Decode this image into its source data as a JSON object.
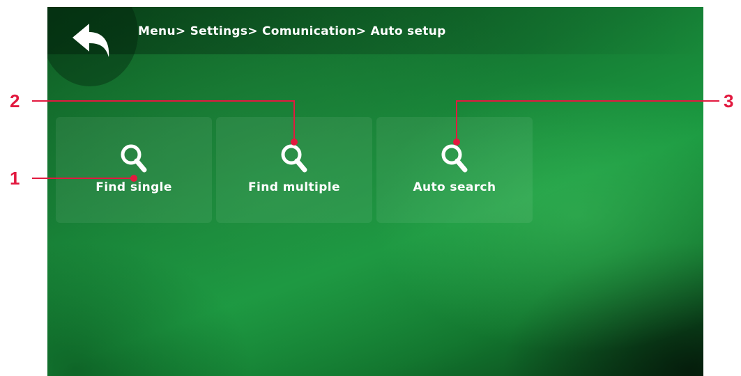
{
  "header": {
    "breadcrumb": "Menu> Settings> Comunication> Auto setup"
  },
  "tiles": [
    {
      "label": "Find single",
      "icon": "search-icon"
    },
    {
      "label": "Find multiple",
      "icon": "search-icon"
    },
    {
      "label": "Auto search",
      "icon": "search-icon"
    }
  ],
  "callouts": [
    "1",
    "2",
    "3"
  ],
  "colors": {
    "accent": "#e2193f",
    "screen_green": "#157a33"
  }
}
